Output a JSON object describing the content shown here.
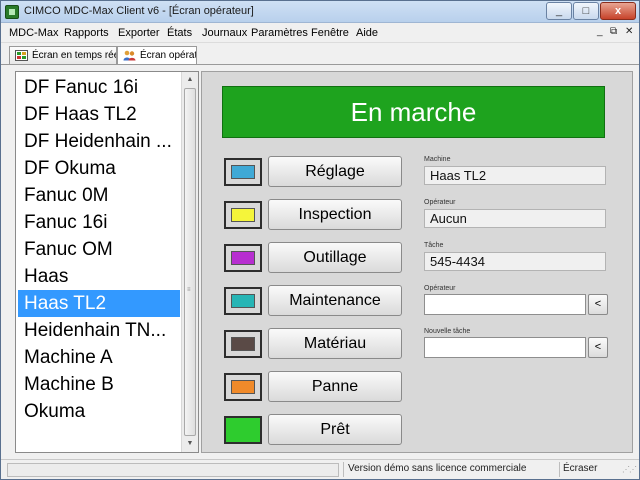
{
  "window": {
    "title": "CIMCO MDC-Max Client v6 - [Écran opérateur]",
    "controls": {
      "minimize": "_",
      "maximize": "□",
      "close": "x"
    }
  },
  "menubar": {
    "items": [
      "MDC-Max",
      "Rapports",
      "Exporter",
      "États",
      "Journaux",
      "Paramètres",
      "Fenêtre",
      "Aide"
    ],
    "mdi_controls": [
      "_",
      "⧉",
      "✕"
    ]
  },
  "tabs": [
    {
      "label": "Écran en temps réel",
      "active": false
    },
    {
      "label": "Écran opérateur",
      "active": true
    }
  ],
  "machine_list": {
    "items": [
      "DF Fanuc 16i",
      "DF Haas TL2",
      "DF Heidenhain ...",
      "DF Okuma",
      "Fanuc 0M",
      "Fanuc 16i",
      "Fanuc OM",
      "Haas",
      "Haas TL2",
      "Heidenhain TN...",
      "Machine A",
      "Machine B",
      "Okuma"
    ],
    "selected": "Haas TL2"
  },
  "status": {
    "text": "En marche",
    "color": "#1ea31e"
  },
  "states": [
    {
      "label": "Réglage",
      "color": "#3fa9d6",
      "border": "#2d2d2d"
    },
    {
      "label": "Inspection",
      "color": "#f5f53a",
      "border": "#2d2d2d"
    },
    {
      "label": "Outillage",
      "color": "#b72ed0",
      "border": "#2d2d2d"
    },
    {
      "label": "Maintenance",
      "color": "#27b5b5",
      "border": "#2d2d2d"
    },
    {
      "label": "Matériau",
      "color": "#5a4a46",
      "border": "#2d2d2d"
    },
    {
      "label": "Panne",
      "color": "#f08a2a",
      "border": "#2d2d2d"
    },
    {
      "label": "Prêt",
      "color": "#2ecc2e",
      "border": "#2d2d2d"
    }
  ],
  "fields": {
    "machine_label": "Machine",
    "machine_value": "Haas TL2",
    "operator_label": "Opérateur",
    "operator_value": "Aucun",
    "task_label": "Tâche",
    "task_value": "545-4434",
    "operator_input_label": "Opérateur",
    "operator_input_value": "",
    "new_task_label": "Nouvelle tâche",
    "new_task_value": "",
    "pick_button": "<"
  },
  "statusbar": {
    "license": "Version démo sans licence commerciale",
    "mode": "Écraser"
  }
}
